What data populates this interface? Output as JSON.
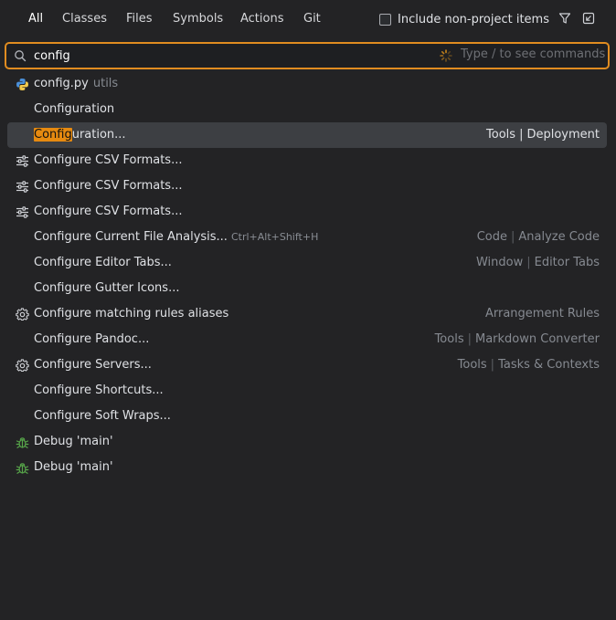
{
  "tabs": [
    "All",
    "Classes",
    "Files",
    "Symbols",
    "Actions",
    "Git"
  ],
  "include_label": "Include non-project items",
  "search": {
    "value": "config",
    "hint": "Type / to see commands"
  },
  "items": [
    {
      "icon": "python-icon",
      "pre": "",
      "hl": "",
      "name": "config.py",
      "suffix": "utils",
      "shortcut": "",
      "loc": []
    },
    {
      "icon": "",
      "pre": "",
      "hl": "",
      "name": "Configuration",
      "suffix": "",
      "shortcut": "",
      "loc": []
    },
    {
      "icon": "",
      "pre": "",
      "hl": "Config",
      "name": "uration...",
      "suffix": "",
      "shortcut": "",
      "loc": [
        "Tools",
        "Deployment"
      ],
      "selected": true
    },
    {
      "icon": "sliders-icon",
      "pre": "",
      "hl": "",
      "name": "Configure CSV Formats...",
      "suffix": "",
      "shortcut": "",
      "loc": []
    },
    {
      "icon": "sliders-icon",
      "pre": "",
      "hl": "",
      "name": "Configure CSV Formats...",
      "suffix": "",
      "shortcut": "",
      "loc": []
    },
    {
      "icon": "sliders-icon",
      "pre": "",
      "hl": "",
      "name": "Configure CSV Formats...",
      "suffix": "",
      "shortcut": "",
      "loc": []
    },
    {
      "icon": "",
      "pre": "",
      "hl": "",
      "name": "Configure Current File Analysis...",
      "suffix": "",
      "shortcut": "Ctrl+Alt+Shift+H",
      "loc": [
        "Code",
        "Analyze Code"
      ]
    },
    {
      "icon": "",
      "pre": "",
      "hl": "",
      "name": "Configure Editor Tabs...",
      "suffix": "",
      "shortcut": "",
      "loc": [
        "Window",
        "Editor Tabs"
      ]
    },
    {
      "icon": "",
      "pre": "",
      "hl": "",
      "name": "Configure Gutter Icons...",
      "suffix": "",
      "shortcut": "",
      "loc": []
    },
    {
      "icon": "gear-icon",
      "pre": "",
      "hl": "",
      "name": "Configure matching rules aliases",
      "suffix": "",
      "shortcut": "",
      "loc": [
        "Arrangement Rules"
      ]
    },
    {
      "icon": "",
      "pre": "",
      "hl": "",
      "name": "Configure Pandoc...",
      "suffix": "",
      "shortcut": "",
      "loc": [
        "Tools",
        "Markdown Converter"
      ]
    },
    {
      "icon": "gear-icon",
      "pre": "",
      "hl": "",
      "name": "Configure Servers...",
      "suffix": "",
      "shortcut": "",
      "loc": [
        "Tools",
        "Tasks & Contexts"
      ]
    },
    {
      "icon": "",
      "pre": "",
      "hl": "",
      "name": "Configure Shortcuts...",
      "suffix": "",
      "shortcut": "",
      "loc": []
    },
    {
      "icon": "",
      "pre": "",
      "hl": "",
      "name": "Configure Soft Wraps...",
      "suffix": "",
      "shortcut": "",
      "loc": []
    },
    {
      "icon": "bug-icon",
      "pre": "",
      "hl": "",
      "name": "Debug 'main'",
      "suffix": "",
      "shortcut": "",
      "loc": []
    },
    {
      "icon": "bug-icon",
      "pre": "",
      "hl": "",
      "name": "Debug 'main'",
      "suffix": "",
      "shortcut": "",
      "loc": []
    }
  ],
  "colors": {
    "accent": "#e08c20",
    "selection": "#3d3f43",
    "highlight": "#e68a10",
    "background": "#232325"
  }
}
